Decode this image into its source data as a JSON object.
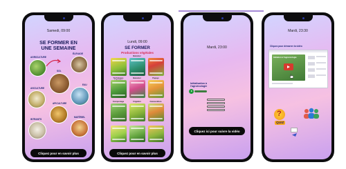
{
  "phones": [
    {
      "time": "Samedi, 09:00",
      "title": "SE FORMER EN UNE SEMAINE",
      "labels": {
        "agriculture": "AGRICULTURE",
        "elevage": "ÉLEVAGE",
        "sol": "SOL",
        "aviculture": "AVICULTURE",
        "eau": "EAU",
        "apiculture": "APICULTURE",
        "intrants": "INTRANTS",
        "materiel": "MATÉRIEL"
      },
      "cta": "Cliquez pour en savoir plus"
    },
    {
      "time": "Lundi, 09:00",
      "title": "SE FORMER",
      "subtitle": "Productions végétales",
      "grid_labels": [
        "",
        "Bananier",
        "",
        "Techniques culturales",
        "Bananier",
        "Papaye",
        "Compostage",
        "Irrigation",
        "Cacaoculture",
        "",
        "",
        ""
      ],
      "cta": "Cliquez pour en savoir plus"
    },
    {
      "time": "Mardi, 23:00",
      "caption": "Initialisation à l'agroécologie",
      "cta": "Cliquez ici pour suivre la vidéo"
    },
    {
      "time": "Mardi, 23:30",
      "hint": "Cliquez pour démarrer la vidéo",
      "video_title": "Initiation à l'agroécologie",
      "badge": "QUIZ"
    }
  ],
  "colors": {
    "cta_bg": "#0a0a0a",
    "title": "#1b1b5a",
    "accent_red": "#d6284d",
    "play_green": "#1a9b3a"
  }
}
